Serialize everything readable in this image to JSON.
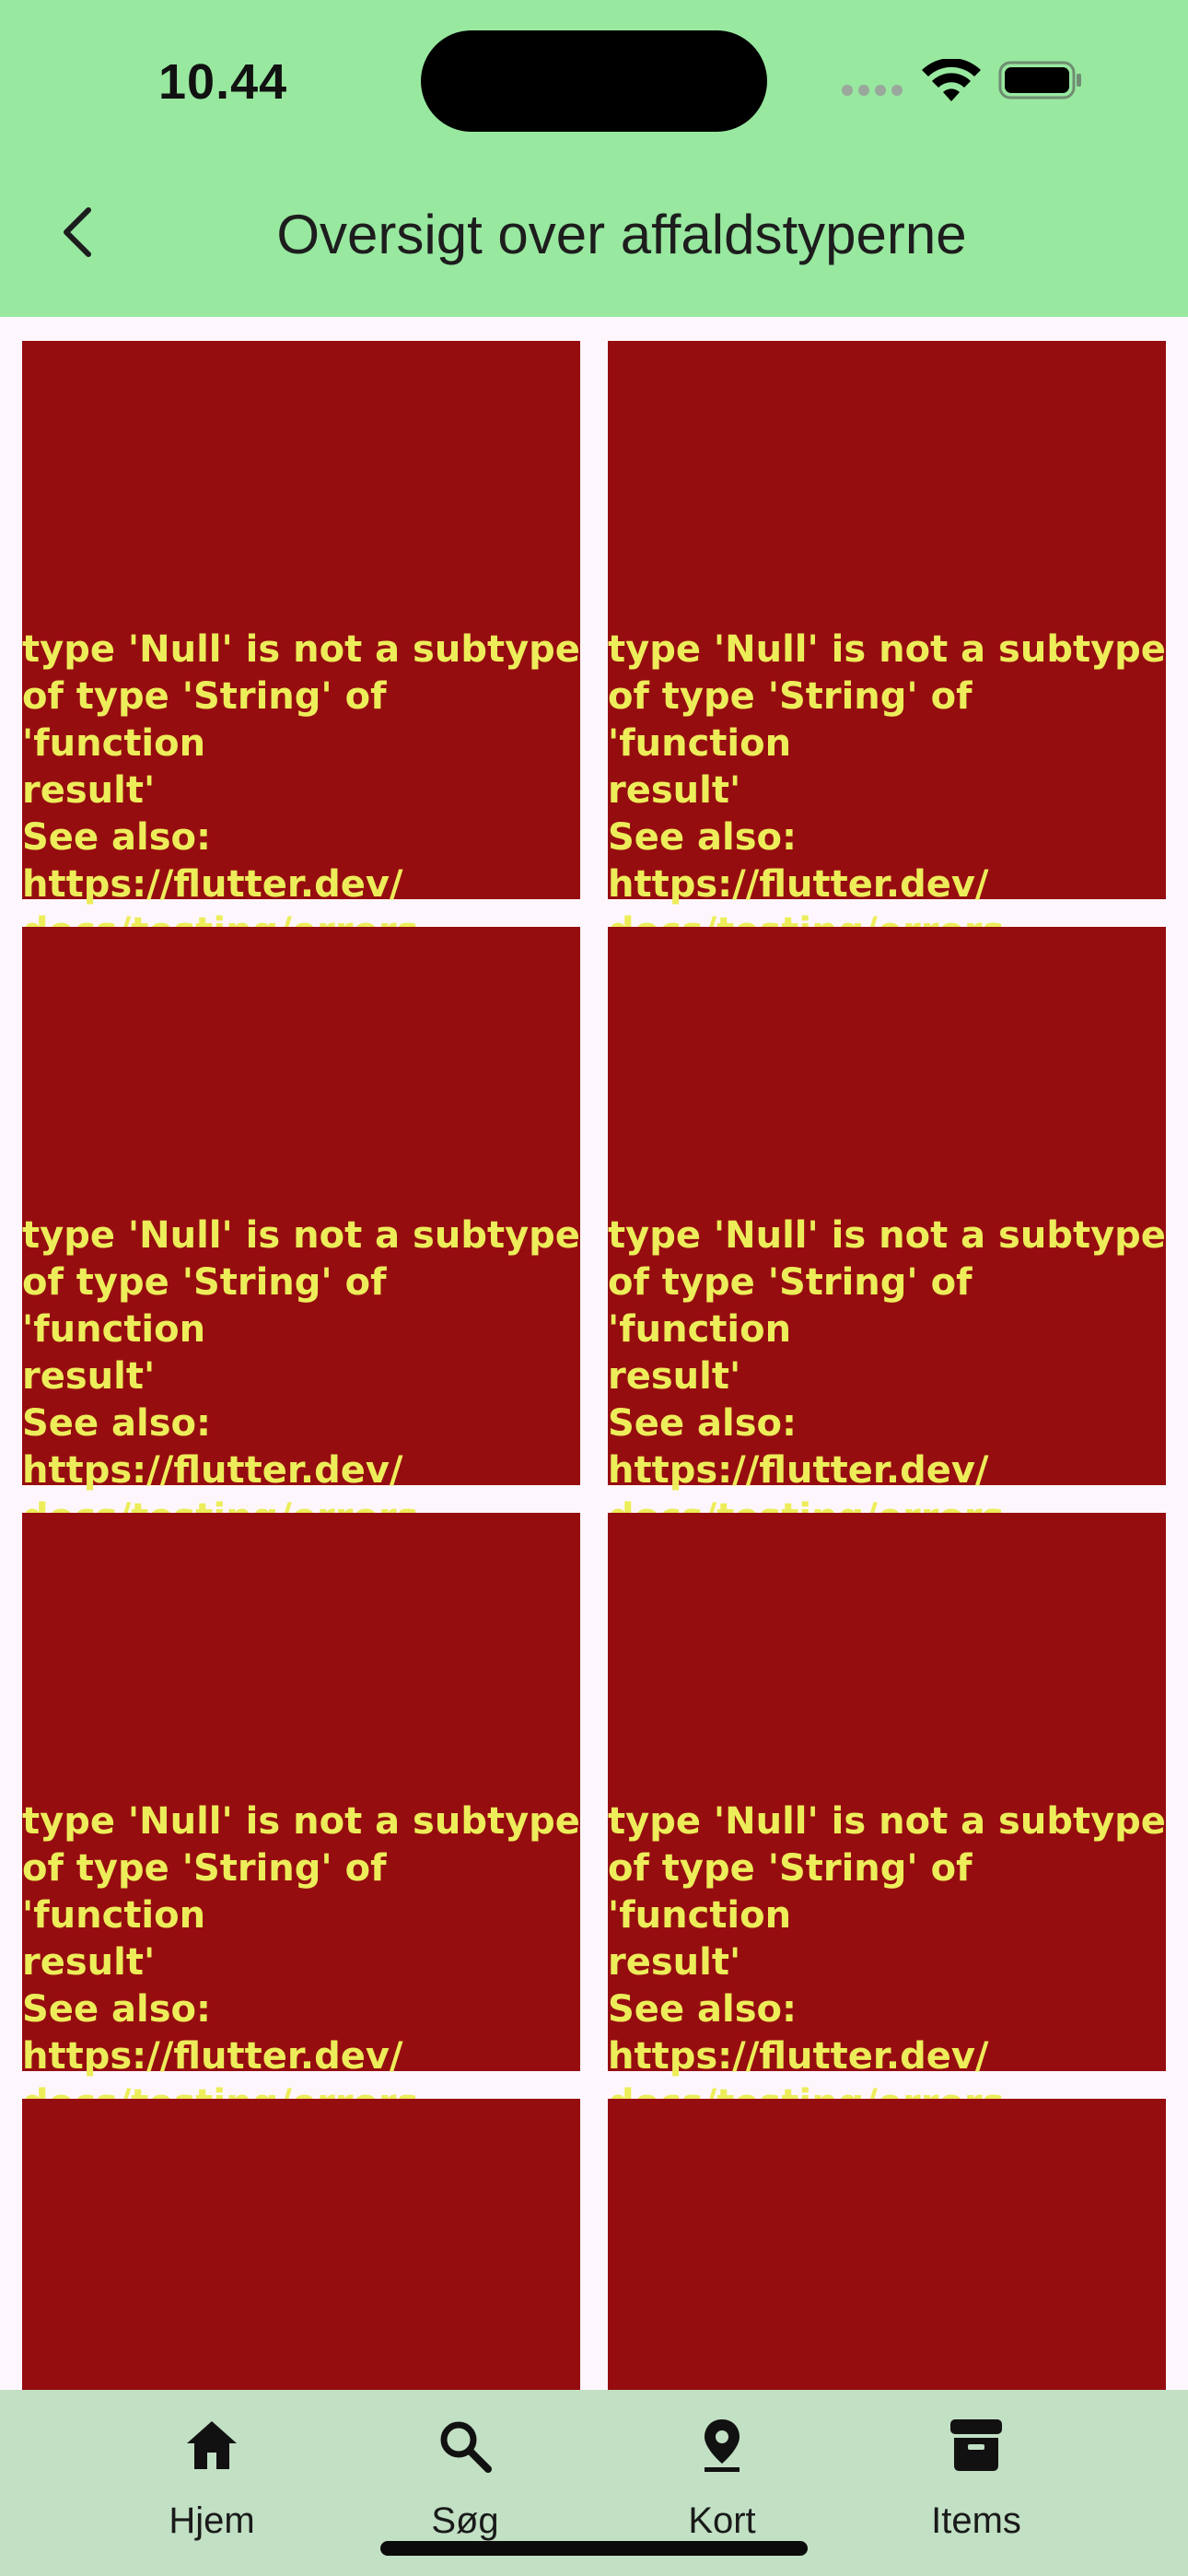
{
  "status_bar": {
    "time": "10.44"
  },
  "app_bar": {
    "title": "Oversigt over affaldstyperne"
  },
  "tiles": [
    {
      "error": "type 'Null' is not a subtype\nof type 'String' of 'function\nresult'\nSee also: https://flutter.dev/\ndocs/testing/errors"
    },
    {
      "error": "type 'Null' is not a subtype\nof type 'String' of 'function\nresult'\nSee also: https://flutter.dev/\ndocs/testing/errors"
    },
    {
      "error": "type 'Null' is not a subtype\nof type 'String' of 'function\nresult'\nSee also: https://flutter.dev/\ndocs/testing/errors"
    },
    {
      "error": "type 'Null' is not a subtype\nof type 'String' of 'function\nresult'\nSee also: https://flutter.dev/\ndocs/testing/errors"
    },
    {
      "error": "type 'Null' is not a subtype\nof type 'String' of 'function\nresult'\nSee also: https://flutter.dev/\ndocs/testing/errors"
    },
    {
      "error": "type 'Null' is not a subtype\nof type 'String' of 'function\nresult'\nSee also: https://flutter.dev/\ndocs/testing/errors"
    }
  ],
  "bottom_nav": {
    "items": [
      {
        "label": "Hjem",
        "icon": "home-icon"
      },
      {
        "label": "Søg",
        "icon": "search-icon"
      },
      {
        "label": "Kort",
        "icon": "location-pin-icon"
      },
      {
        "label": "Items",
        "icon": "archive-icon"
      }
    ]
  },
  "colors": {
    "app_bar": "#98e8a0",
    "bottom_nav": "#c2e0c4",
    "error_tile": "#960d10",
    "error_text": "#eded5a",
    "background": "#fdf7fd"
  }
}
